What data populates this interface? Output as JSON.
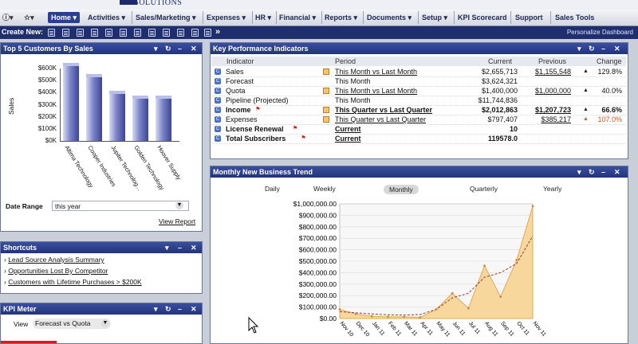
{
  "brand": {
    "text": "IT SOLUTIONS"
  },
  "nav": {
    "items": [
      {
        "label": "Home ▾",
        "active": true
      },
      {
        "label": "Activities ▾"
      },
      {
        "label": "Sales/Marketing ▾"
      },
      {
        "label": "Expenses ▾"
      },
      {
        "label": "HR ▾"
      },
      {
        "label": "Financial ▾"
      },
      {
        "label": "Reports ▾"
      },
      {
        "label": "Documents ▾"
      },
      {
        "label": "Setup ▾"
      },
      {
        "label": "KPI Scorecard"
      },
      {
        "label": "Support"
      },
      {
        "label": "Sales Tools"
      }
    ]
  },
  "create_bar": {
    "label": "Create New:",
    "more": "»",
    "personalize": "Personalize Dashboard"
  },
  "panel_controls": {
    "down": "▾",
    "refresh": "↻",
    "min": "–",
    "close": "✕"
  },
  "top_customers": {
    "title": "Top 5 Customers By Sales",
    "ylabel": "Sales",
    "yticks": [
      "$600K",
      "$500K",
      "$400K",
      "$300K",
      "$200K",
      "$100K",
      "$0K"
    ],
    "date_range_label": "Date Range",
    "date_range_value": "this year",
    "view_report": "View Report"
  },
  "chart_data": [
    {
      "type": "bar",
      "title": "Top 5 Customers By Sales",
      "ylabel": "Sales",
      "categories": [
        "Altima Technology",
        "Cooper Industries",
        "Jupiter Technolog...",
        "Golden Technology",
        "Hoover Supply"
      ],
      "values": [
        630000,
        540000,
        405000,
        365000,
        362000
      ],
      "ylim": [
        0,
        600000
      ]
    },
    {
      "type": "area",
      "title": "Monthly New Business Trend",
      "x": [
        "Nov 10",
        "Dec 10",
        "Jan 11",
        "Feb 11",
        "Mar 11",
        "Apr 11",
        "May 11",
        "Jun 11",
        "Jul 11",
        "Aug 11",
        "Sep 11",
        "Oct 11",
        "Nov 11"
      ],
      "values": [
        80000,
        40000,
        20000,
        15000,
        15000,
        10000,
        80000,
        220000,
        90000,
        460000,
        190000,
        510000,
        980000
      ],
      "trend": [
        60000,
        50000,
        40000,
        32000,
        30000,
        35000,
        80000,
        180000,
        220000,
        360000,
        400000,
        480000,
        720000
      ],
      "ylim": [
        0,
        1000000
      ]
    }
  ],
  "kpi": {
    "title": "Key Performance Indicators",
    "headers": [
      "Indicator",
      "Period",
      "Current",
      "Previous",
      "Change"
    ],
    "rows": [
      {
        "indicator": "Sales",
        "period": "This Month vs Last Month",
        "current": "$2,655,713",
        "previous": "$1,155,548",
        "arrow": "▲",
        "change": "129.8%",
        "chart": true,
        "bold": false
      },
      {
        "indicator": "Forecast",
        "period": "This Month",
        "current": "$3,624,321",
        "previous": "",
        "arrow": "",
        "change": "",
        "chart": false,
        "bold": false
      },
      {
        "indicator": "Quota",
        "period": "This Month vs Last Month",
        "current": "$1,400,000",
        "previous": "$1,000,000",
        "arrow": "▲",
        "change": "40.0%",
        "chart": true,
        "bold": false
      },
      {
        "indicator": "Pipeline (Projected)",
        "period": "This Month",
        "current": "$11,744,836",
        "previous": "",
        "arrow": "",
        "change": "",
        "chart": false,
        "bold": false
      },
      {
        "indicator": "Income",
        "period": "This Quarter vs Last Quarter",
        "current": "$2,012,863",
        "previous": "$1,207,723",
        "arrow": "▲",
        "change": "66.6%",
        "chart": true,
        "bold": true,
        "flag": true
      },
      {
        "indicator": "Expenses",
        "period": "This Quarter vs Last Quarter",
        "current": "$797,407",
        "previous": "$385,217",
        "arrow": "▲",
        "change": "107.0%",
        "chart": true,
        "bold": false,
        "neg": true
      },
      {
        "indicator": "License Renewal",
        "period": "Current",
        "current": "10",
        "previous": "",
        "arrow": "",
        "change": "",
        "chart": false,
        "bold": true,
        "flag": true
      },
      {
        "indicator": "Total Subscribers",
        "period": "Current",
        "current": "119578.0",
        "previous": "",
        "arrow": "",
        "change": "",
        "chart": false,
        "bold": true,
        "flag": true
      }
    ]
  },
  "trend": {
    "title": "Monthly New Business Trend",
    "tabs": [
      "Daily",
      "Weekly",
      "Monthly",
      "Quarterly",
      "Yearly"
    ],
    "yticks": [
      "$1,000,000.00",
      "$900,000.00",
      "$800,000.00",
      "$700,000.00",
      "$600,000.00",
      "$500,000.00",
      "$400,000.00",
      "$300,000.00",
      "$200,000.00",
      "$100,000.00",
      "$0.00"
    ]
  },
  "shortcuts": {
    "title": "Shortcuts",
    "items": [
      "Lead Source Analysis Summary",
      "Opportunities Lost By Competitor",
      "Customers with Lifetime Purchases > $200K"
    ]
  },
  "kpi_meter": {
    "title": "KPI Meter",
    "view_label": "View",
    "view_value": "Forecast vs Quota"
  }
}
